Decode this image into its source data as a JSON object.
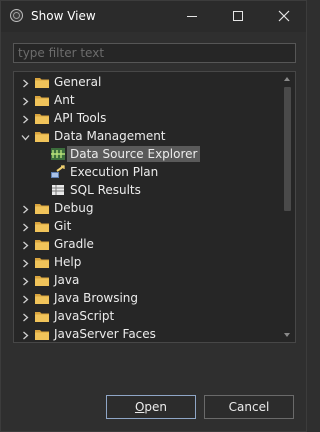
{
  "window": {
    "title": "Show View",
    "controls": {
      "minimize": "minimize",
      "maximize": "maximize",
      "close": "close"
    }
  },
  "filter": {
    "placeholder": "type filter text",
    "value": ""
  },
  "tree": {
    "items": [
      {
        "label": "General",
        "type": "folder",
        "expanded": false,
        "level": 0,
        "selected": false
      },
      {
        "label": "Ant",
        "type": "folder",
        "expanded": false,
        "level": 0,
        "selected": false
      },
      {
        "label": "API Tools",
        "type": "folder",
        "expanded": false,
        "level": 0,
        "selected": false
      },
      {
        "label": "Data Management",
        "type": "folder",
        "expanded": true,
        "level": 0,
        "selected": false
      },
      {
        "label": "Data Source Explorer",
        "type": "view",
        "icon": "data-source-icon",
        "level": 1,
        "selected": true
      },
      {
        "label": "Execution Plan",
        "type": "view",
        "icon": "execution-plan-icon",
        "level": 1,
        "selected": false
      },
      {
        "label": "SQL Results",
        "type": "view",
        "icon": "sql-results-icon",
        "level": 1,
        "selected": false
      },
      {
        "label": "Debug",
        "type": "folder",
        "expanded": false,
        "level": 0,
        "selected": false
      },
      {
        "label": "Git",
        "type": "folder",
        "expanded": false,
        "level": 0,
        "selected": false
      },
      {
        "label": "Gradle",
        "type": "folder",
        "expanded": false,
        "level": 0,
        "selected": false
      },
      {
        "label": "Help",
        "type": "folder",
        "expanded": false,
        "level": 0,
        "selected": false
      },
      {
        "label": "Java",
        "type": "folder",
        "expanded": false,
        "level": 0,
        "selected": false
      },
      {
        "label": "Java Browsing",
        "type": "folder",
        "expanded": false,
        "level": 0,
        "selected": false
      },
      {
        "label": "JavaScript",
        "type": "folder",
        "expanded": false,
        "level": 0,
        "selected": false
      },
      {
        "label": "JavaServer Faces",
        "type": "folder",
        "expanded": false,
        "level": 0,
        "selected": false
      }
    ]
  },
  "buttons": {
    "open": {
      "mnemonic": "O",
      "rest": "pen"
    },
    "cancel": {
      "label": "Cancel"
    }
  },
  "colors": {
    "background": "#2f2f2f",
    "panel": "#262626",
    "selection": "#5a5a5a",
    "folder": "#e6b44a",
    "text": "#ececec"
  }
}
